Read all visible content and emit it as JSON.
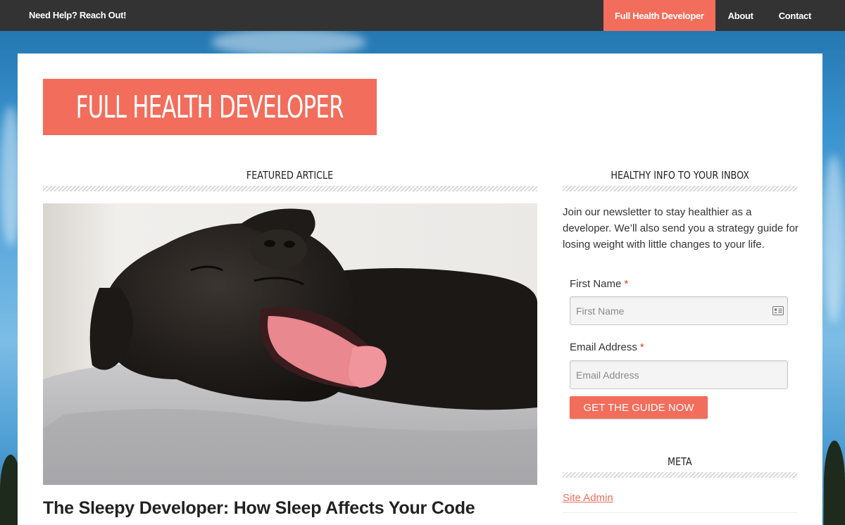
{
  "topbar": {
    "help_text": "Need Help? Reach Out!",
    "nav": [
      {
        "label": "Full Health Developer",
        "active": true
      },
      {
        "label": "About",
        "active": false
      },
      {
        "label": "Contact",
        "active": false
      }
    ]
  },
  "site": {
    "brand_title": "FULL HEALTH DEVELOPER"
  },
  "main": {
    "featured_heading": "FEATURED ARTICLE",
    "article_title": "The Sleepy Developer: How Sleep Affects Your Code"
  },
  "sidebar": {
    "newsletter_heading": "HEALTHY INFO TO YOUR INBOX",
    "newsletter_text": "Join our newsletter to stay healthier as a developer. We’ll also send you a strategy guide for losing weight with little changes to your life.",
    "first_name_label": "First Name",
    "first_name_placeholder": "First Name",
    "email_label": "Email Address",
    "email_placeholder": "Email Address",
    "required_marker": "*",
    "cta_label": "GET THE GUIDE NOW",
    "meta_heading": "META",
    "meta_links": [
      "Site Admin"
    ]
  },
  "colors": {
    "accent": "#f26d5b",
    "topbar": "#333333",
    "text": "#222222"
  }
}
